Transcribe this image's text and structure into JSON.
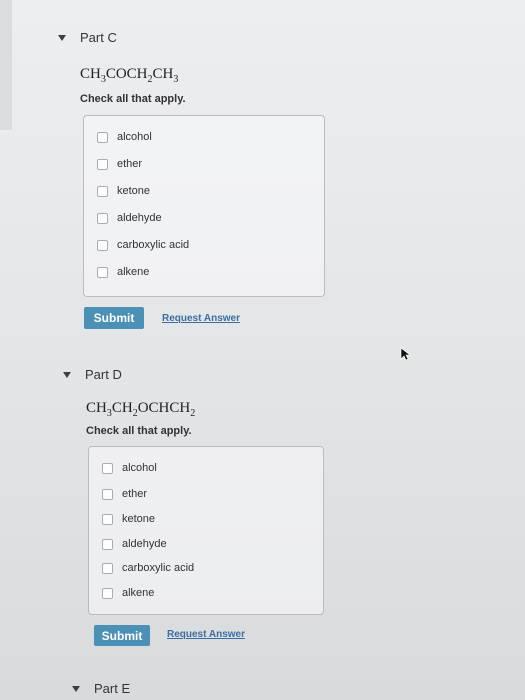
{
  "partC": {
    "title": "Part C",
    "formula": [
      {
        "t": "CH"
      },
      {
        "s": "3"
      },
      {
        "t": "COCH"
      },
      {
        "s": "2"
      },
      {
        "t": "CH"
      },
      {
        "s": "3"
      }
    ],
    "instruction": "Check all that apply.",
    "options": [
      "alcohol",
      "ether",
      "ketone",
      "aldehyde",
      "carboxylic acid",
      "alkene"
    ],
    "submit_label": "Submit",
    "request_label": "Request Answer"
  },
  "partD": {
    "title": "Part D",
    "formula": [
      {
        "t": "CH"
      },
      {
        "s": "3"
      },
      {
        "t": "CH"
      },
      {
        "s": "2"
      },
      {
        "t": "OCHCH"
      },
      {
        "s": "2"
      }
    ],
    "instruction": "Check all that apply.",
    "options": [
      "alcohol",
      "ether",
      "ketone",
      "aldehyde",
      "carboxylic acid",
      "alkene"
    ],
    "submit_label": "Submit",
    "request_label": "Request Answer"
  },
  "partE": {
    "title": "Part E"
  },
  "colors": {
    "submit_bg": "#4b91b5",
    "link": "#3b6fa3"
  }
}
